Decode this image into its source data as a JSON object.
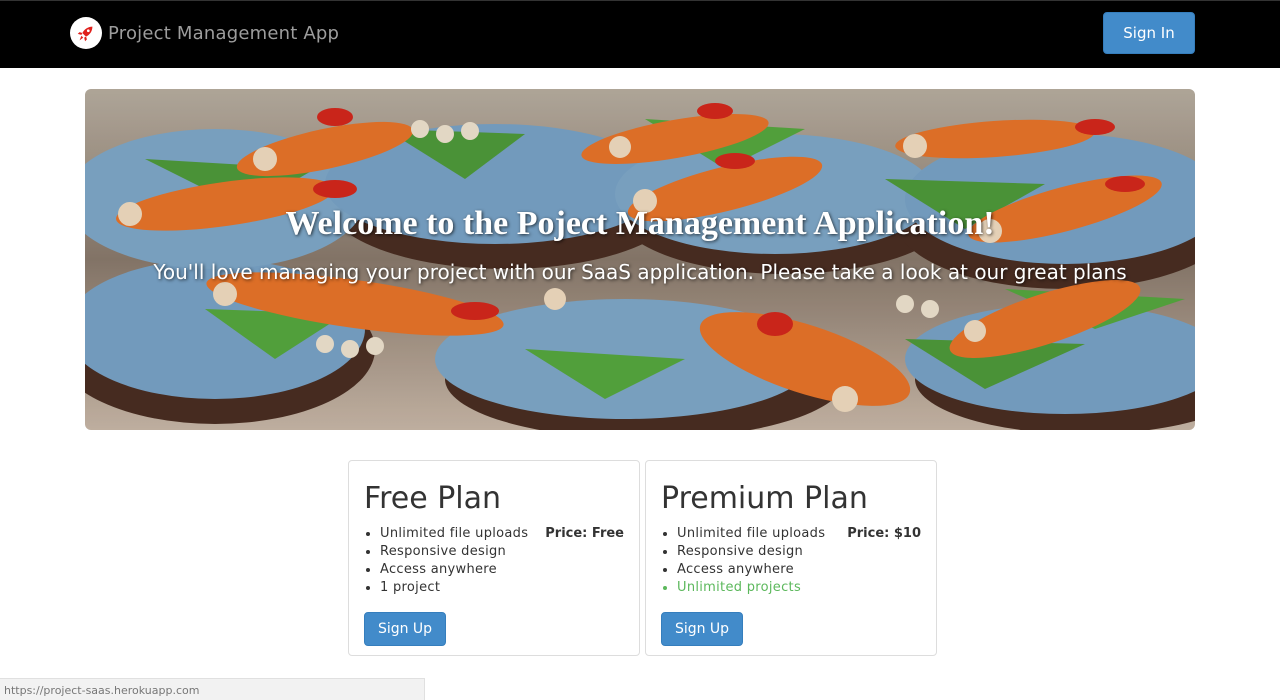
{
  "navbar": {
    "brand_icon": "rocket-icon",
    "brand_text": "Project Management App",
    "signin_label": "Sign In"
  },
  "hero": {
    "title": "Welcome to the Poject Management Application!",
    "subtitle": "You'll love managing your project with our SaaS application. Please take a look at our great plans"
  },
  "plans": [
    {
      "name": "Free Plan",
      "price": "Price: Free",
      "features": [
        "Unlimited file uploads",
        "Responsive design",
        "Access anywhere",
        "1 project"
      ],
      "signup_label": "Sign Up"
    },
    {
      "name": "Premium Plan",
      "price": "Price: $10",
      "features": [
        "Unlimited file uploads",
        "Responsive design",
        "Access anywhere",
        "Unlimited projects"
      ],
      "signup_label": "Sign Up"
    }
  ],
  "status_bar": {
    "url": "https://project-saas.herokuapp.com"
  },
  "colors": {
    "navbar_bg": "#000000",
    "primary_button": "#428bca",
    "highlight_feature": "#5cb85c"
  }
}
